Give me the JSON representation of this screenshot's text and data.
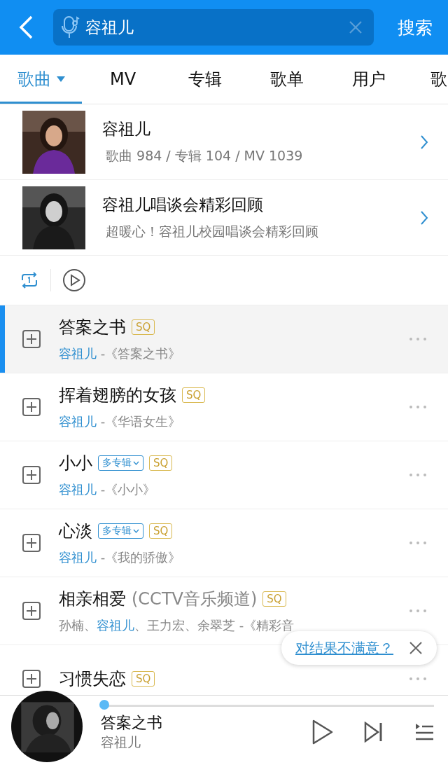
{
  "search": {
    "value": "容祖儿",
    "button": "搜索"
  },
  "tabs": [
    {
      "label": "歌曲",
      "selected": true
    },
    {
      "label": "MV",
      "selected": false
    },
    {
      "label": "专辑",
      "selected": false
    },
    {
      "label": "歌单",
      "selected": false
    },
    {
      "label": "用户",
      "selected": false
    },
    {
      "label": "歌",
      "selected": false
    }
  ],
  "cards": [
    {
      "title": "容祖儿",
      "subtitle": "歌曲 984 / 专辑 104 / MV 1039",
      "kind": "picture"
    },
    {
      "title": "容祖儿唱谈会精彩回顾",
      "subtitle": "超暖心！容祖儿校园唱谈会精彩回顾",
      "kind": "picture"
    }
  ],
  "songs": [
    {
      "title": "答案之书",
      "playing": true,
      "badges": [
        {
          "kind": "sq",
          "label": "SQ"
        }
      ],
      "subtitle": [
        {
          "text": "容祖儿",
          "highlight": true
        },
        {
          "text": " -《答案之书》",
          "highlight": false
        }
      ]
    },
    {
      "title": "挥着翅膀的女孩",
      "playing": false,
      "badges": [
        {
          "kind": "sq",
          "label": "SQ"
        }
      ],
      "subtitle": [
        {
          "text": "容祖儿",
          "highlight": true
        },
        {
          "text": " -《华语女生》",
          "highlight": false
        }
      ]
    },
    {
      "title": "小小",
      "playing": false,
      "badges": [
        {
          "kind": "multi",
          "label": "多专辑"
        },
        {
          "kind": "sq",
          "label": "SQ"
        }
      ],
      "subtitle": [
        {
          "text": "容祖儿",
          "highlight": true
        },
        {
          "text": " -《小小》",
          "highlight": false
        }
      ]
    },
    {
      "title": "心淡",
      "playing": false,
      "badges": [
        {
          "kind": "multi",
          "label": "多专辑"
        },
        {
          "kind": "sq",
          "label": "SQ"
        }
      ],
      "subtitle": [
        {
          "text": "容祖儿",
          "highlight": true
        },
        {
          "text": " -《我的骄傲》",
          "highlight": false
        }
      ]
    },
    {
      "title": "相亲相爱",
      "title_note": "(CCTV音乐频道)",
      "playing": false,
      "badges": [
        {
          "kind": "sq",
          "label": "SQ"
        }
      ],
      "subtitle": [
        {
          "text": "孙楠、",
          "highlight": false
        },
        {
          "text": "容祖儿",
          "highlight": true
        },
        {
          "text": "、王力宏、余翠芝 -《精彩音",
          "highlight": false
        }
      ]
    },
    {
      "title": "习惯失恋",
      "playing": false,
      "badges": [
        {
          "kind": "sq",
          "label": "SQ"
        }
      ]
    }
  ],
  "feedback": {
    "link": "对结果不满意？"
  },
  "player": {
    "title": "答案之书",
    "artist": "容祖儿",
    "level": 0.01
  }
}
